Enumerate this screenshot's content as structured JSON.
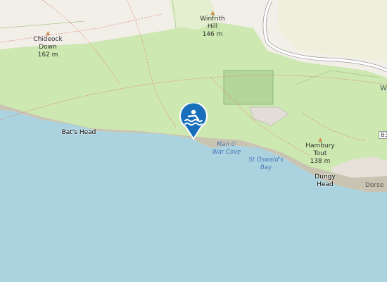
{
  "colors": {
    "sea": "#aad3df",
    "land": "#f2efe9",
    "grass": "#cde8b0",
    "cliff": "#c9c4b2",
    "road": "#ffffff",
    "pin": "#1a6fba"
  },
  "peaks": [
    {
      "name": "Chideock\nDown",
      "elevation": "162 m"
    },
    {
      "name": "Winfrith\nHill",
      "elevation": "146 m"
    },
    {
      "name": "Hambury\nTout",
      "elevation": "138 m"
    }
  ],
  "places": {
    "bats_head": "Bat's Head",
    "dungy_head": "Dungy\nHead",
    "man_o_war_cove": "Man o'\nWar Cove",
    "st_oswalds_bay": "St Oswald's\nBay",
    "dorset_fragment": "Dorse",
    "w_fragment": "W",
    "road_ref_fragment": "B3"
  },
  "marker": {
    "icon": "swimming-icon"
  }
}
